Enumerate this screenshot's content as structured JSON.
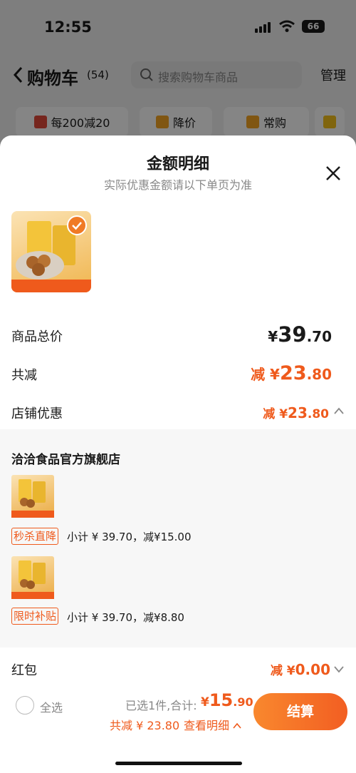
{
  "status": {
    "time": "12:55",
    "battery": "66"
  },
  "nav": {
    "title": "购物车",
    "count": "(54)",
    "search_placeholder": "搜索购物车商品",
    "manage": "管理"
  },
  "filters": [
    {
      "label": "每200减20"
    },
    {
      "label": "降价"
    },
    {
      "label": "常购"
    }
  ],
  "sheet": {
    "title": "金额明细",
    "subtitle": "实际优惠金额请以下单页为准",
    "total_label": "商品总价",
    "total_prefix": "¥",
    "total_main": "39",
    "total_cents": ".70",
    "discount_label": "共减",
    "discount_prefix": "减 ¥",
    "discount_main": "23",
    "discount_cents": ".80",
    "store_label": "店铺优惠",
    "store_prefix": "减 ¥",
    "store_main": "23",
    "store_cents": ".80"
  },
  "detail": {
    "shop_name": "洽洽食品官方旗舰店",
    "items": [
      {
        "tag": "秒杀直降",
        "subtotal": "小计 ¥ 39.70，减¥15.00"
      },
      {
        "tag": "限时补贴",
        "subtotal": "小计 ¥ 39.70，减¥8.80"
      }
    ]
  },
  "hongbao": {
    "label": "红包",
    "prefix": "减 ¥",
    "value": "0.00"
  },
  "bottom": {
    "select_all": "全选",
    "selected_info": "已选1件,合计:",
    "total_prefix": "¥",
    "total_main": "15",
    "total_cents": ".90",
    "discount_text": "共减 ¥ 23.80",
    "view_detail": "查看明细",
    "checkout": "结算"
  },
  "colors": {
    "accent": "#ef5a1c",
    "button_gradient_start": "#f9882e"
  }
}
